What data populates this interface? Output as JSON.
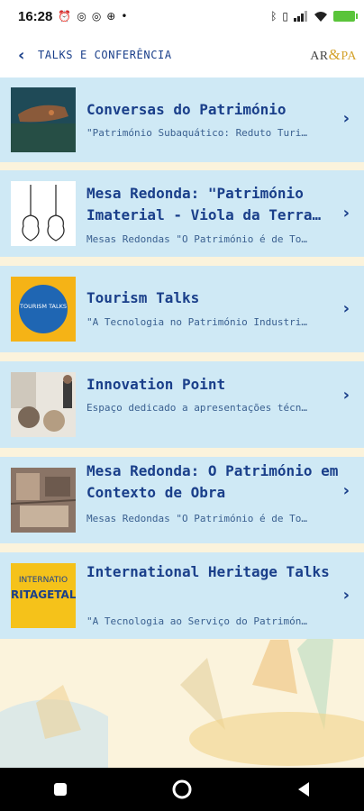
{
  "statusbar": {
    "time": "16:28",
    "left_icons": [
      "alarm-icon",
      "whatsapp-icon",
      "whatsapp-icon",
      "game-icon"
    ],
    "dot": "•"
  },
  "header": {
    "back": "‹",
    "title": "TALKS E CONFERÊNCIA",
    "logo_left": "AR",
    "logo_amp": "&",
    "logo_right": "PA"
  },
  "items": [
    {
      "title": "Conversas do Património",
      "subtitle": "\"Património Subaquático: Reduto Turi…",
      "thumb": "underwater-photo"
    },
    {
      "title": "Mesa Redonda: \"Património Imaterial - Viola da Terra…",
      "subtitle": "Mesas Redondas \"O Património é de To…",
      "thumb": "guitars-drawing"
    },
    {
      "title": "Tourism Talks",
      "subtitle": "\"A Tecnologia no Património Industri…",
      "thumb": "tourism-talks-logo",
      "thumb_text": "TOURISM TALKS"
    },
    {
      "title": "Innovation Point",
      "subtitle": "Espaço dedicado a apresentações técn…",
      "thumb": "presentation-photo"
    },
    {
      "title": "Mesa Redonda: O Património em Contexto de Obra",
      "subtitle": "Mesas Redondas \"O Património é de To…",
      "thumb": "ruins-photo"
    },
    {
      "title": "International Heritage Talks",
      "subtitle": "\"A Tecnologia ao Serviço do Patrimón…",
      "thumb": "heritage-talks-logo",
      "thumb_text_top": "INTERNATIO",
      "thumb_text_bottom": "RITAGETAL"
    }
  ],
  "colors": {
    "card": "#cfe9f5",
    "title": "#1a3f8a",
    "background": "#fbf3dc",
    "accent": "#d4a22b"
  }
}
